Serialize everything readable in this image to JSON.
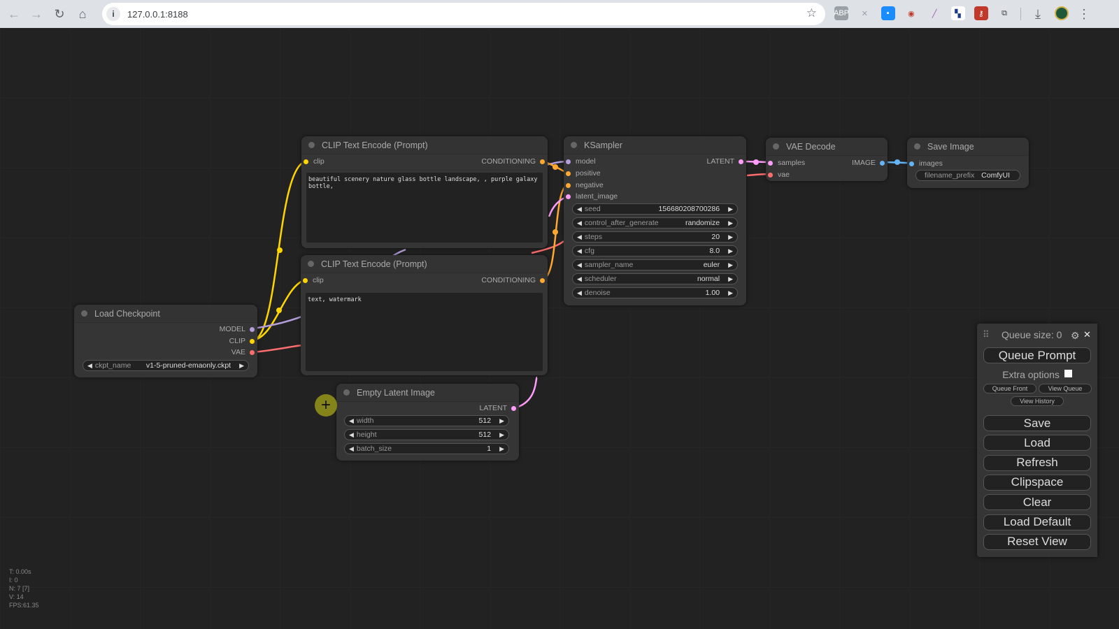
{
  "browser": {
    "url": "127.0.0.1:8188",
    "back_icon": "←",
    "forward_icon": "→",
    "reload_icon": "↻",
    "home_icon": "⌂",
    "info_icon": "i",
    "star_icon": "☆",
    "extensions": [
      {
        "name": "abp-extension-icon",
        "glyph": "ABP",
        "bg": "#9aa0a6",
        "fg": "#fff"
      },
      {
        "name": "x-extension-icon",
        "glyph": "✕",
        "bg": "transparent",
        "fg": "#9aa0a6"
      },
      {
        "name": "blue-square-extension-icon",
        "glyph": "▪",
        "bg": "#1a8cff",
        "fg": "#fff"
      },
      {
        "name": "chart-extension-icon",
        "glyph": "◉",
        "bg": "transparent",
        "fg": "#c0392b"
      },
      {
        "name": "pen-extension-icon",
        "glyph": "╱",
        "bg": "transparent",
        "fg": "#9b59b6"
      },
      {
        "name": "grid-extension-icon",
        "glyph": "▚",
        "bg": "#fff",
        "fg": "#1a3a8a"
      },
      {
        "name": "key-extension-icon",
        "glyph": "⚷",
        "bg": "#c0392b",
        "fg": "#fff"
      },
      {
        "name": "puzzle-extension-icon",
        "glyph": "⧉",
        "bg": "transparent",
        "fg": "#3c4043"
      }
    ],
    "download_icon": "⤓",
    "menu_icon": "⋮"
  },
  "nodes": {
    "clip_pos": {
      "title": "CLIP Text Encode (Prompt)",
      "input": "clip",
      "output": "CONDITIONING",
      "text": "beautiful scenery nature glass bottle landscape, , purple galaxy bottle,"
    },
    "clip_neg": {
      "title": "CLIP Text Encode (Prompt)",
      "input": "clip",
      "output": "CONDITIONING",
      "text": "text, watermark"
    },
    "ksampler": {
      "title": "KSampler",
      "inputs": [
        "model",
        "positive",
        "negative",
        "latent_image"
      ],
      "output": "LATENT",
      "widgets": [
        {
          "label": "seed",
          "value": "156680208700286"
        },
        {
          "label": "control_after_generate",
          "value": "randomize"
        },
        {
          "label": "steps",
          "value": "20"
        },
        {
          "label": "cfg",
          "value": "8.0"
        },
        {
          "label": "sampler_name",
          "value": "euler"
        },
        {
          "label": "scheduler",
          "value": "normal"
        },
        {
          "label": "denoise",
          "value": "1.00"
        }
      ]
    },
    "vae_decode": {
      "title": "VAE Decode",
      "inputs": [
        "samples",
        "vae"
      ],
      "output": "IMAGE"
    },
    "save_image": {
      "title": "Save Image",
      "input": "images",
      "widget": {
        "label": "filename_prefix",
        "value": "ComfyUI"
      }
    },
    "load_checkpoint": {
      "title": "Load Checkpoint",
      "outputs": [
        "MODEL",
        "CLIP",
        "VAE"
      ],
      "widget": {
        "label": "ckpt_name",
        "value": "v1-5-pruned-emaonly.ckpt"
      }
    },
    "empty_latent": {
      "title": "Empty Latent Image",
      "output": "LATENT",
      "widgets": [
        {
          "label": "width",
          "value": "512"
        },
        {
          "label": "height",
          "value": "512"
        },
        {
          "label": "batch_size",
          "value": "1"
        }
      ]
    }
  },
  "colors": {
    "model": "#b39ddb",
    "clip": "#ffd500",
    "vae": "#ff6e6e",
    "conditioning": "#ffa931",
    "latent": "#ff9cf9",
    "image": "#64b5f6"
  },
  "queue_panel": {
    "queue_size_label": "Queue size: 0",
    "queue_prompt": "Queue Prompt",
    "extra_options": "Extra options",
    "extra_options_checked": false,
    "queue_front": "Queue Front",
    "view_queue": "View Queue",
    "view_history": "View History",
    "buttons": [
      "Save",
      "Load",
      "Refresh",
      "Clipspace",
      "Clear",
      "Load Default",
      "Reset View"
    ],
    "gear_icon": "⚙",
    "close_icon": "✕",
    "drag_icon": "⠿"
  },
  "stats": [
    "T: 0.00s",
    "I: 0",
    "N: 7 [7]",
    "V: 14",
    "FPS:61.35"
  ]
}
